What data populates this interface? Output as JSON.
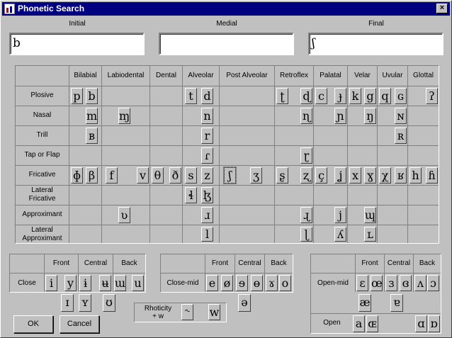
{
  "window": {
    "title": "Phonetic Search",
    "close_glyph": "×"
  },
  "fields": {
    "initial": {
      "label": "Initial",
      "value": "b"
    },
    "medial": {
      "label": "Medial",
      "value": ""
    },
    "final": {
      "label": "Final",
      "value": "ʃ"
    }
  },
  "consonants": {
    "columns": [
      "Bilabial",
      "Labiodental",
      "Dental",
      "Alveolar",
      "Post Alveolar",
      "Retroflex",
      "Palatal",
      "Velar",
      "Uvular",
      "Glottal"
    ],
    "rows": [
      "Plosive",
      "Nasal",
      "Trill",
      "Tap or Flap",
      "Fricative",
      "Lateral Fricative",
      "Approximant",
      "Lateral Approximant"
    ],
    "keys": [
      {
        "row": 0,
        "col": 0,
        "slot": 0,
        "sym": "p"
      },
      {
        "row": 0,
        "col": 0,
        "slot": 1,
        "sym": "b"
      },
      {
        "row": 0,
        "col": 3,
        "slot": 0,
        "sym": "t"
      },
      {
        "row": 0,
        "col": 3,
        "slot": 1,
        "sym": "d"
      },
      {
        "row": 0,
        "col": 5,
        "slot": 0,
        "sym": "ʈ"
      },
      {
        "row": 0,
        "col": 5,
        "slot": 1,
        "sym": "ɖ"
      },
      {
        "row": 0,
        "col": 6,
        "slot": 0,
        "sym": "c"
      },
      {
        "row": 0,
        "col": 6,
        "slot": 1,
        "sym": "ɟ"
      },
      {
        "row": 0,
        "col": 7,
        "slot": 0,
        "sym": "k"
      },
      {
        "row": 0,
        "col": 7,
        "slot": 1,
        "sym": "g"
      },
      {
        "row": 0,
        "col": 8,
        "slot": 0,
        "sym": "q"
      },
      {
        "row": 0,
        "col": 8,
        "slot": 1,
        "sym": "ɢ"
      },
      {
        "row": 0,
        "col": 9,
        "slot": 1,
        "sym": "ʔ"
      },
      {
        "row": 1,
        "col": 0,
        "slot": 1,
        "sym": "m"
      },
      {
        "row": 1,
        "col": 1,
        "slot": 1,
        "sym": "ɱ"
      },
      {
        "row": 1,
        "col": 3,
        "slot": 1,
        "sym": "n"
      },
      {
        "row": 1,
        "col": 5,
        "slot": 1,
        "sym": "ɳ"
      },
      {
        "row": 1,
        "col": 6,
        "slot": 1,
        "sym": "ɲ"
      },
      {
        "row": 1,
        "col": 7,
        "slot": 1,
        "sym": "ŋ"
      },
      {
        "row": 1,
        "col": 8,
        "slot": 1,
        "sym": "ɴ"
      },
      {
        "row": 2,
        "col": 0,
        "slot": 1,
        "sym": "ʙ"
      },
      {
        "row": 2,
        "col": 3,
        "slot": 1,
        "sym": "r"
      },
      {
        "row": 2,
        "col": 8,
        "slot": 1,
        "sym": "ʀ"
      },
      {
        "row": 3,
        "col": 3,
        "slot": 1,
        "sym": "ɾ"
      },
      {
        "row": 3,
        "col": 5,
        "slot": 1,
        "sym": "ɽ"
      },
      {
        "row": 4,
        "col": 0,
        "slot": 0,
        "sym": "ɸ"
      },
      {
        "row": 4,
        "col": 0,
        "slot": 1,
        "sym": "β"
      },
      {
        "row": 4,
        "col": 1,
        "slot": 0,
        "sym": "f"
      },
      {
        "row": 4,
        "col": 1,
        "slot": 1,
        "sym": "v"
      },
      {
        "row": 4,
        "col": 2,
        "slot": 0,
        "sym": "θ"
      },
      {
        "row": 4,
        "col": 2,
        "slot": 1,
        "sym": "ð"
      },
      {
        "row": 4,
        "col": 3,
        "slot": 0,
        "sym": "s"
      },
      {
        "row": 4,
        "col": 3,
        "slot": 1,
        "sym": "z"
      },
      {
        "row": 4,
        "col": 4,
        "slot": 0,
        "sym": "ʃ",
        "selected": true
      },
      {
        "row": 4,
        "col": 4,
        "slot": 1,
        "sym": "ʒ"
      },
      {
        "row": 4,
        "col": 5,
        "slot": 0,
        "sym": "ʂ"
      },
      {
        "row": 4,
        "col": 5,
        "slot": 1,
        "sym": "ʐ"
      },
      {
        "row": 4,
        "col": 6,
        "slot": 0,
        "sym": "ç"
      },
      {
        "row": 4,
        "col": 6,
        "slot": 1,
        "sym": "ʝ"
      },
      {
        "row": 4,
        "col": 7,
        "slot": 0,
        "sym": "x"
      },
      {
        "row": 4,
        "col": 7,
        "slot": 1,
        "sym": "ɣ"
      },
      {
        "row": 4,
        "col": 8,
        "slot": 0,
        "sym": "χ"
      },
      {
        "row": 4,
        "col": 8,
        "slot": 1,
        "sym": "ʁ"
      },
      {
        "row": 4,
        "col": 9,
        "slot": 0,
        "sym": "h"
      },
      {
        "row": 4,
        "col": 9,
        "slot": 1,
        "sym": "ɦ"
      },
      {
        "row": 5,
        "col": 3,
        "slot": 0,
        "sym": "ɬ"
      },
      {
        "row": 5,
        "col": 3,
        "slot": 1,
        "sym": "ɮ"
      },
      {
        "row": 6,
        "col": 1,
        "slot": 1,
        "sym": "ʋ"
      },
      {
        "row": 6,
        "col": 3,
        "slot": 1,
        "sym": "ɹ"
      },
      {
        "row": 6,
        "col": 5,
        "slot": 1,
        "sym": "ɻ"
      },
      {
        "row": 6,
        "col": 6,
        "slot": 1,
        "sym": "j"
      },
      {
        "row": 6,
        "col": 7,
        "slot": 1,
        "sym": "ɰ"
      },
      {
        "row": 7,
        "col": 3,
        "slot": 1,
        "sym": "l"
      },
      {
        "row": 7,
        "col": 5,
        "slot": 1,
        "sym": "ɭ"
      },
      {
        "row": 7,
        "col": 6,
        "slot": 1,
        "sym": "ʎ"
      },
      {
        "row": 7,
        "col": 7,
        "slot": 1,
        "sym": "ʟ"
      }
    ]
  },
  "vowels": {
    "close": {
      "row_label": "Close",
      "headers": [
        "Front",
        "Central",
        "Back"
      ],
      "row1": [
        "i",
        "y",
        "ɨ",
        "ʉ",
        "ɯ",
        "u"
      ],
      "row2": [
        "ɪ",
        "ʏ",
        "ʊ"
      ]
    },
    "close_mid": {
      "row_label": "Close-mid",
      "headers": [
        "Front",
        "Central",
        "Back"
      ],
      "row1": [
        "e",
        "ø",
        "ɘ",
        "ɵ",
        "ɤ",
        "o"
      ],
      "row2": [
        "ə"
      ]
    },
    "open_mid": {
      "row_label": "Open-mid",
      "headers": [
        "Front",
        "Central",
        "Back"
      ],
      "row1": [
        "ɛ",
        "œ",
        "ɜ",
        "ɞ",
        "ʌ",
        "ɔ"
      ],
      "row2": [
        "æ",
        "ɐ"
      ]
    },
    "open": {
      "row_label": "Open",
      "keys": [
        "a",
        "ɶ",
        "ɑ",
        "ɒ"
      ]
    }
  },
  "rhoticity": {
    "label_line1": "Rhoticity",
    "label_line2": "+ w",
    "keys": [
      "˞",
      "w"
    ]
  },
  "buttons": {
    "ok": "OK",
    "cancel": "Cancel"
  }
}
